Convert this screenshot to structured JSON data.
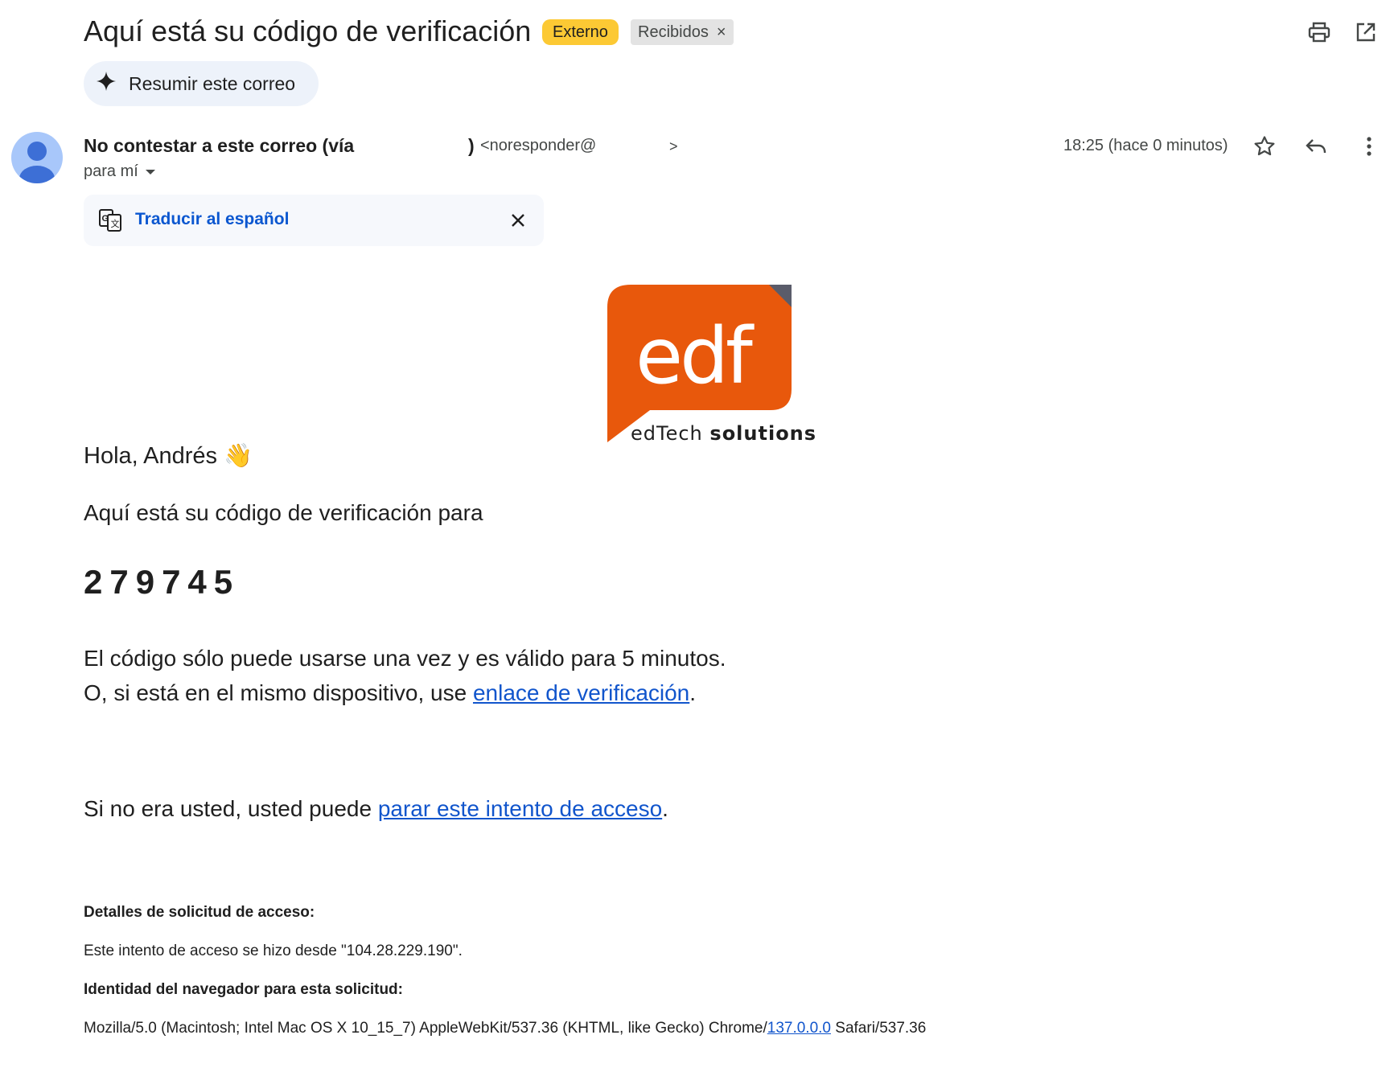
{
  "header": {
    "subject": "Aquí está su código de verificación",
    "badge_external": "Externo",
    "badge_inbox": "Recibidos",
    "badge_inbox_remove": "×",
    "print_icon": "printer-icon",
    "open_new_window_icon": "open-in-new-icon",
    "summarize_label": "Resumir este correo",
    "summarize_icon": "sparkle-icon"
  },
  "sender": {
    "name": "No contestar a este correo (vía",
    "name_close": ")",
    "email_prefix": "<noresponder@",
    "email_suffix": ">",
    "recipient": "para mí",
    "timestamp": "18:25 (hace 0 minutos)",
    "avatar_icon": "person-avatar-icon"
  },
  "translate": {
    "link": "Traducir al español",
    "icon": "translate-icon"
  },
  "logo": {
    "mark": "edf",
    "tagline_light": "edTech",
    "tagline_bold": "solutions",
    "brand_color": "#e8580c",
    "corner_color": "#5a5c6a"
  },
  "body": {
    "greeting": "Hola, Andrés 👋",
    "intro": "Aquí está su código de verificación para",
    "code": "279745",
    "validity": "El código sólo puede usarse una vez y es válido para 5 minutos.",
    "same_device_pre": "O, si está en el mismo dispositivo, use ",
    "same_device_link": "enlace de verificación",
    "same_device_post": ".",
    "not_you_pre": "Si no era usted, usted puede ",
    "not_you_link": "parar este intento de acceso",
    "not_you_post": "."
  },
  "details": {
    "heading": "Detalles de solicitud de acceso:",
    "ip_line": "Este intento de acceso se hizo desde \"104.28.229.190\".",
    "browser_heading": "Identidad del navegador para esta solicitud:",
    "ua_pre": "Mozilla/5.0 (Macintosh; Intel Mac OS X 10_15_7) AppleWebKit/537.36 (KHTML, like Gecko) Chrome/",
    "ua_link": "137.0.0.0",
    "ua_post": " Safari/537.36"
  },
  "colors": {
    "link": "#1155cc",
    "external_badge": "#fcc934",
    "summarize_bg": "#edf2fa"
  }
}
